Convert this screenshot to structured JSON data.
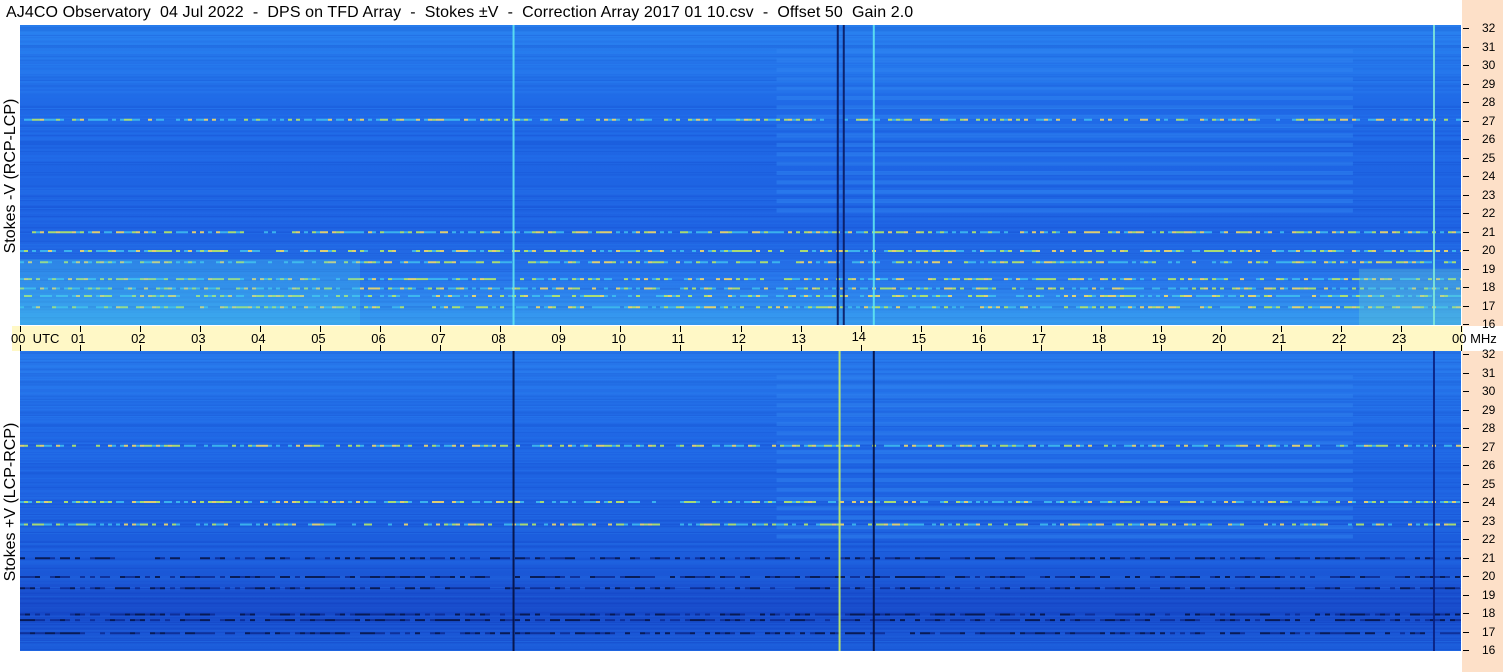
{
  "header": {
    "title": "AJ4CO Observatory  04 Jul 2022  -  DPS on TFD Array  -  Stokes ±V  -  Correction Array 2017 01 10.csv  -  Offset 50  Gain 2.0"
  },
  "chart_data": [
    {
      "type": "heatmap",
      "name_label": "Stokes -V (RCP-LCP)",
      "ylabel": "Stokes -V (RCP-LCP)",
      "yunit": "MHz",
      "ylim": [
        16,
        32
      ],
      "xlim": [
        0,
        24
      ],
      "colormap": [
        "#081070",
        "#1040c8",
        "#1e6ef0",
        "#3fc0f0",
        "#bff060",
        "#ffe060"
      ],
      "base_color": "#1d5fe0",
      "bright_bands_mhz": [
        17.0,
        17.6,
        18.0,
        18.5,
        19.4,
        20.0,
        21.0,
        27.0
      ],
      "vertical_lines_utc": [
        {
          "t": 8.22,
          "color": "#5fe6f0"
        },
        {
          "t": 13.62,
          "color": "#0a1a60"
        },
        {
          "t": 13.72,
          "color": "#0a1a60"
        },
        {
          "t": 14.22,
          "color": "#5fe6f0"
        },
        {
          "t": 23.55,
          "color": "#7fe8d8"
        }
      ]
    },
    {
      "type": "heatmap",
      "name_label": "Stokes +V (LCP-RCP)",
      "ylabel": "Stokes +V (LCP-RCP)",
      "yunit": "MHz",
      "ylim": [
        16,
        32
      ],
      "xlim": [
        0,
        24
      ],
      "colormap": [
        "#081070",
        "#1040c8",
        "#1e6ef0",
        "#3fc0f0",
        "#bff060",
        "#ffe060"
      ],
      "base_color": "#1a56d8",
      "bright_bands_mhz": [
        27.0,
        22.8,
        24.0
      ],
      "dark_bands_mhz": [
        17.0,
        17.7,
        18.0,
        19.4,
        20.0,
        21.0
      ],
      "vertical_lines_utc": [
        {
          "t": 8.22,
          "color": "#061040"
        },
        {
          "t": 13.65,
          "color": "#c8f060"
        },
        {
          "t": 14.22,
          "color": "#061040"
        },
        {
          "t": 23.55,
          "color": "#0a2080"
        }
      ]
    }
  ],
  "time_axis": {
    "ticks": [
      "00",
      "01",
      "02",
      "03",
      "04",
      "05",
      "06",
      "07",
      "08",
      "09",
      "10",
      "11",
      "12",
      "13",
      "14",
      "15",
      "16",
      "17",
      "18",
      "19",
      "20",
      "21",
      "22",
      "23",
      "00"
    ],
    "first_label": "00  UTC",
    "last_label": "00 MHz"
  },
  "freq_axis": {
    "ticks": [
      "32",
      "31",
      "30",
      "29",
      "28",
      "27",
      "26",
      "25",
      "24",
      "23",
      "22",
      "21",
      "20",
      "19",
      "18",
      "17",
      "16"
    ]
  },
  "colors": {
    "utc_band": "#fff8c6",
    "freq_axis_bg": "#fde0c8"
  }
}
